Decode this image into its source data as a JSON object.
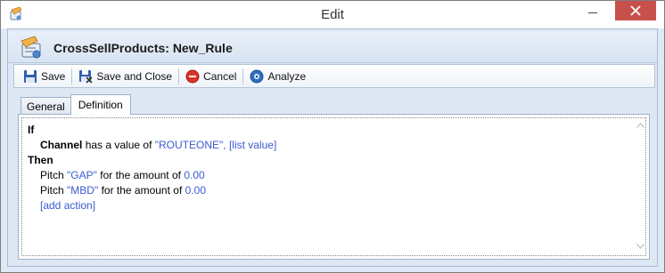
{
  "window": {
    "title": "Edit",
    "icon": "rule-editor-icon",
    "close_color": "#c7504b"
  },
  "header": {
    "title": "CrossSellProducts: New_Rule",
    "icon": "rule-document-icon"
  },
  "toolbar": {
    "save_label": "Save",
    "save_close_label": "Save and Close",
    "cancel_label": "Cancel",
    "analyze_label": "Analyze"
  },
  "tabs": [
    {
      "label": "General",
      "active": false
    },
    {
      "label": "Definition",
      "active": true
    }
  ],
  "rule": {
    "if_keyword": "If",
    "condition": {
      "field": "Channel",
      "operator_text": "has a value of",
      "value": "\"ROUTEONE\",",
      "link": "[list value]"
    },
    "then_keyword": "Then",
    "actions": [
      {
        "prefix": "Pitch",
        "value": "\"GAP\"",
        "middle": "for the amount of",
        "amount": "0.00"
      },
      {
        "prefix": "Pitch",
        "value": "\"MBD\"",
        "middle": "for the amount of",
        "amount": "0.00"
      }
    ],
    "add_action_link": "[add action]"
  },
  "colors": {
    "link_blue": "#3b5bd0",
    "frame_blue": "#dde8f4"
  }
}
